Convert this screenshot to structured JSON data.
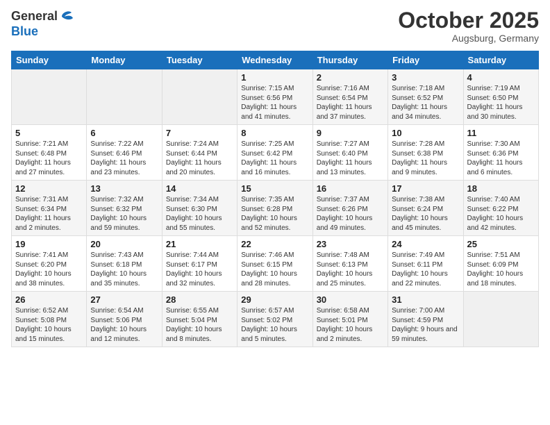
{
  "logo": {
    "general": "General",
    "blue": "Blue"
  },
  "header": {
    "title": "October 2025",
    "subtitle": "Augsburg, Germany"
  },
  "weekdays": [
    "Sunday",
    "Monday",
    "Tuesday",
    "Wednesday",
    "Thursday",
    "Friday",
    "Saturday"
  ],
  "weeks": [
    [
      {
        "day": "",
        "info": ""
      },
      {
        "day": "",
        "info": ""
      },
      {
        "day": "",
        "info": ""
      },
      {
        "day": "1",
        "info": "Sunrise: 7:15 AM\nSunset: 6:56 PM\nDaylight: 11 hours and 41 minutes."
      },
      {
        "day": "2",
        "info": "Sunrise: 7:16 AM\nSunset: 6:54 PM\nDaylight: 11 hours and 37 minutes."
      },
      {
        "day": "3",
        "info": "Sunrise: 7:18 AM\nSunset: 6:52 PM\nDaylight: 11 hours and 34 minutes."
      },
      {
        "day": "4",
        "info": "Sunrise: 7:19 AM\nSunset: 6:50 PM\nDaylight: 11 hours and 30 minutes."
      }
    ],
    [
      {
        "day": "5",
        "info": "Sunrise: 7:21 AM\nSunset: 6:48 PM\nDaylight: 11 hours and 27 minutes."
      },
      {
        "day": "6",
        "info": "Sunrise: 7:22 AM\nSunset: 6:46 PM\nDaylight: 11 hours and 23 minutes."
      },
      {
        "day": "7",
        "info": "Sunrise: 7:24 AM\nSunset: 6:44 PM\nDaylight: 11 hours and 20 minutes."
      },
      {
        "day": "8",
        "info": "Sunrise: 7:25 AM\nSunset: 6:42 PM\nDaylight: 11 hours and 16 minutes."
      },
      {
        "day": "9",
        "info": "Sunrise: 7:27 AM\nSunset: 6:40 PM\nDaylight: 11 hours and 13 minutes."
      },
      {
        "day": "10",
        "info": "Sunrise: 7:28 AM\nSunset: 6:38 PM\nDaylight: 11 hours and 9 minutes."
      },
      {
        "day": "11",
        "info": "Sunrise: 7:30 AM\nSunset: 6:36 PM\nDaylight: 11 hours and 6 minutes."
      }
    ],
    [
      {
        "day": "12",
        "info": "Sunrise: 7:31 AM\nSunset: 6:34 PM\nDaylight: 11 hours and 2 minutes."
      },
      {
        "day": "13",
        "info": "Sunrise: 7:32 AM\nSunset: 6:32 PM\nDaylight: 10 hours and 59 minutes."
      },
      {
        "day": "14",
        "info": "Sunrise: 7:34 AM\nSunset: 6:30 PM\nDaylight: 10 hours and 55 minutes."
      },
      {
        "day": "15",
        "info": "Sunrise: 7:35 AM\nSunset: 6:28 PM\nDaylight: 10 hours and 52 minutes."
      },
      {
        "day": "16",
        "info": "Sunrise: 7:37 AM\nSunset: 6:26 PM\nDaylight: 10 hours and 49 minutes."
      },
      {
        "day": "17",
        "info": "Sunrise: 7:38 AM\nSunset: 6:24 PM\nDaylight: 10 hours and 45 minutes."
      },
      {
        "day": "18",
        "info": "Sunrise: 7:40 AM\nSunset: 6:22 PM\nDaylight: 10 hours and 42 minutes."
      }
    ],
    [
      {
        "day": "19",
        "info": "Sunrise: 7:41 AM\nSunset: 6:20 PM\nDaylight: 10 hours and 38 minutes."
      },
      {
        "day": "20",
        "info": "Sunrise: 7:43 AM\nSunset: 6:18 PM\nDaylight: 10 hours and 35 minutes."
      },
      {
        "day": "21",
        "info": "Sunrise: 7:44 AM\nSunset: 6:17 PM\nDaylight: 10 hours and 32 minutes."
      },
      {
        "day": "22",
        "info": "Sunrise: 7:46 AM\nSunset: 6:15 PM\nDaylight: 10 hours and 28 minutes."
      },
      {
        "day": "23",
        "info": "Sunrise: 7:48 AM\nSunset: 6:13 PM\nDaylight: 10 hours and 25 minutes."
      },
      {
        "day": "24",
        "info": "Sunrise: 7:49 AM\nSunset: 6:11 PM\nDaylight: 10 hours and 22 minutes."
      },
      {
        "day": "25",
        "info": "Sunrise: 7:51 AM\nSunset: 6:09 PM\nDaylight: 10 hours and 18 minutes."
      }
    ],
    [
      {
        "day": "26",
        "info": "Sunrise: 6:52 AM\nSunset: 5:08 PM\nDaylight: 10 hours and 15 minutes."
      },
      {
        "day": "27",
        "info": "Sunrise: 6:54 AM\nSunset: 5:06 PM\nDaylight: 10 hours and 12 minutes."
      },
      {
        "day": "28",
        "info": "Sunrise: 6:55 AM\nSunset: 5:04 PM\nDaylight: 10 hours and 8 minutes."
      },
      {
        "day": "29",
        "info": "Sunrise: 6:57 AM\nSunset: 5:02 PM\nDaylight: 10 hours and 5 minutes."
      },
      {
        "day": "30",
        "info": "Sunrise: 6:58 AM\nSunset: 5:01 PM\nDaylight: 10 hours and 2 minutes."
      },
      {
        "day": "31",
        "info": "Sunrise: 7:00 AM\nSunset: 4:59 PM\nDaylight: 9 hours and 59 minutes."
      },
      {
        "day": "",
        "info": ""
      }
    ]
  ]
}
